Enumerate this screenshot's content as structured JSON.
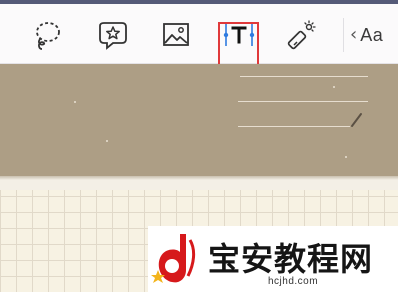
{
  "toolbar": {
    "tools": [
      {
        "name": "lasso",
        "icon": "lasso-icon"
      },
      {
        "name": "sticker",
        "icon": "sticker-icon"
      },
      {
        "name": "image",
        "icon": "image-icon"
      },
      {
        "name": "text",
        "icon": "text-box-icon",
        "selected": true,
        "highlight_color": "#e0393b"
      },
      {
        "name": "highlighter",
        "icon": "highlighter-icon"
      }
    ],
    "font_tool": {
      "chevron": "‹",
      "label": "Aa"
    }
  },
  "watermark": {
    "title": "宝安教程网",
    "url": "hcjhd.com"
  },
  "colors": {
    "top_strip": "#555a78",
    "banner": "#ad9e85",
    "grid_paper": "#f7f2e3",
    "accent_red": "#e0393b"
  }
}
